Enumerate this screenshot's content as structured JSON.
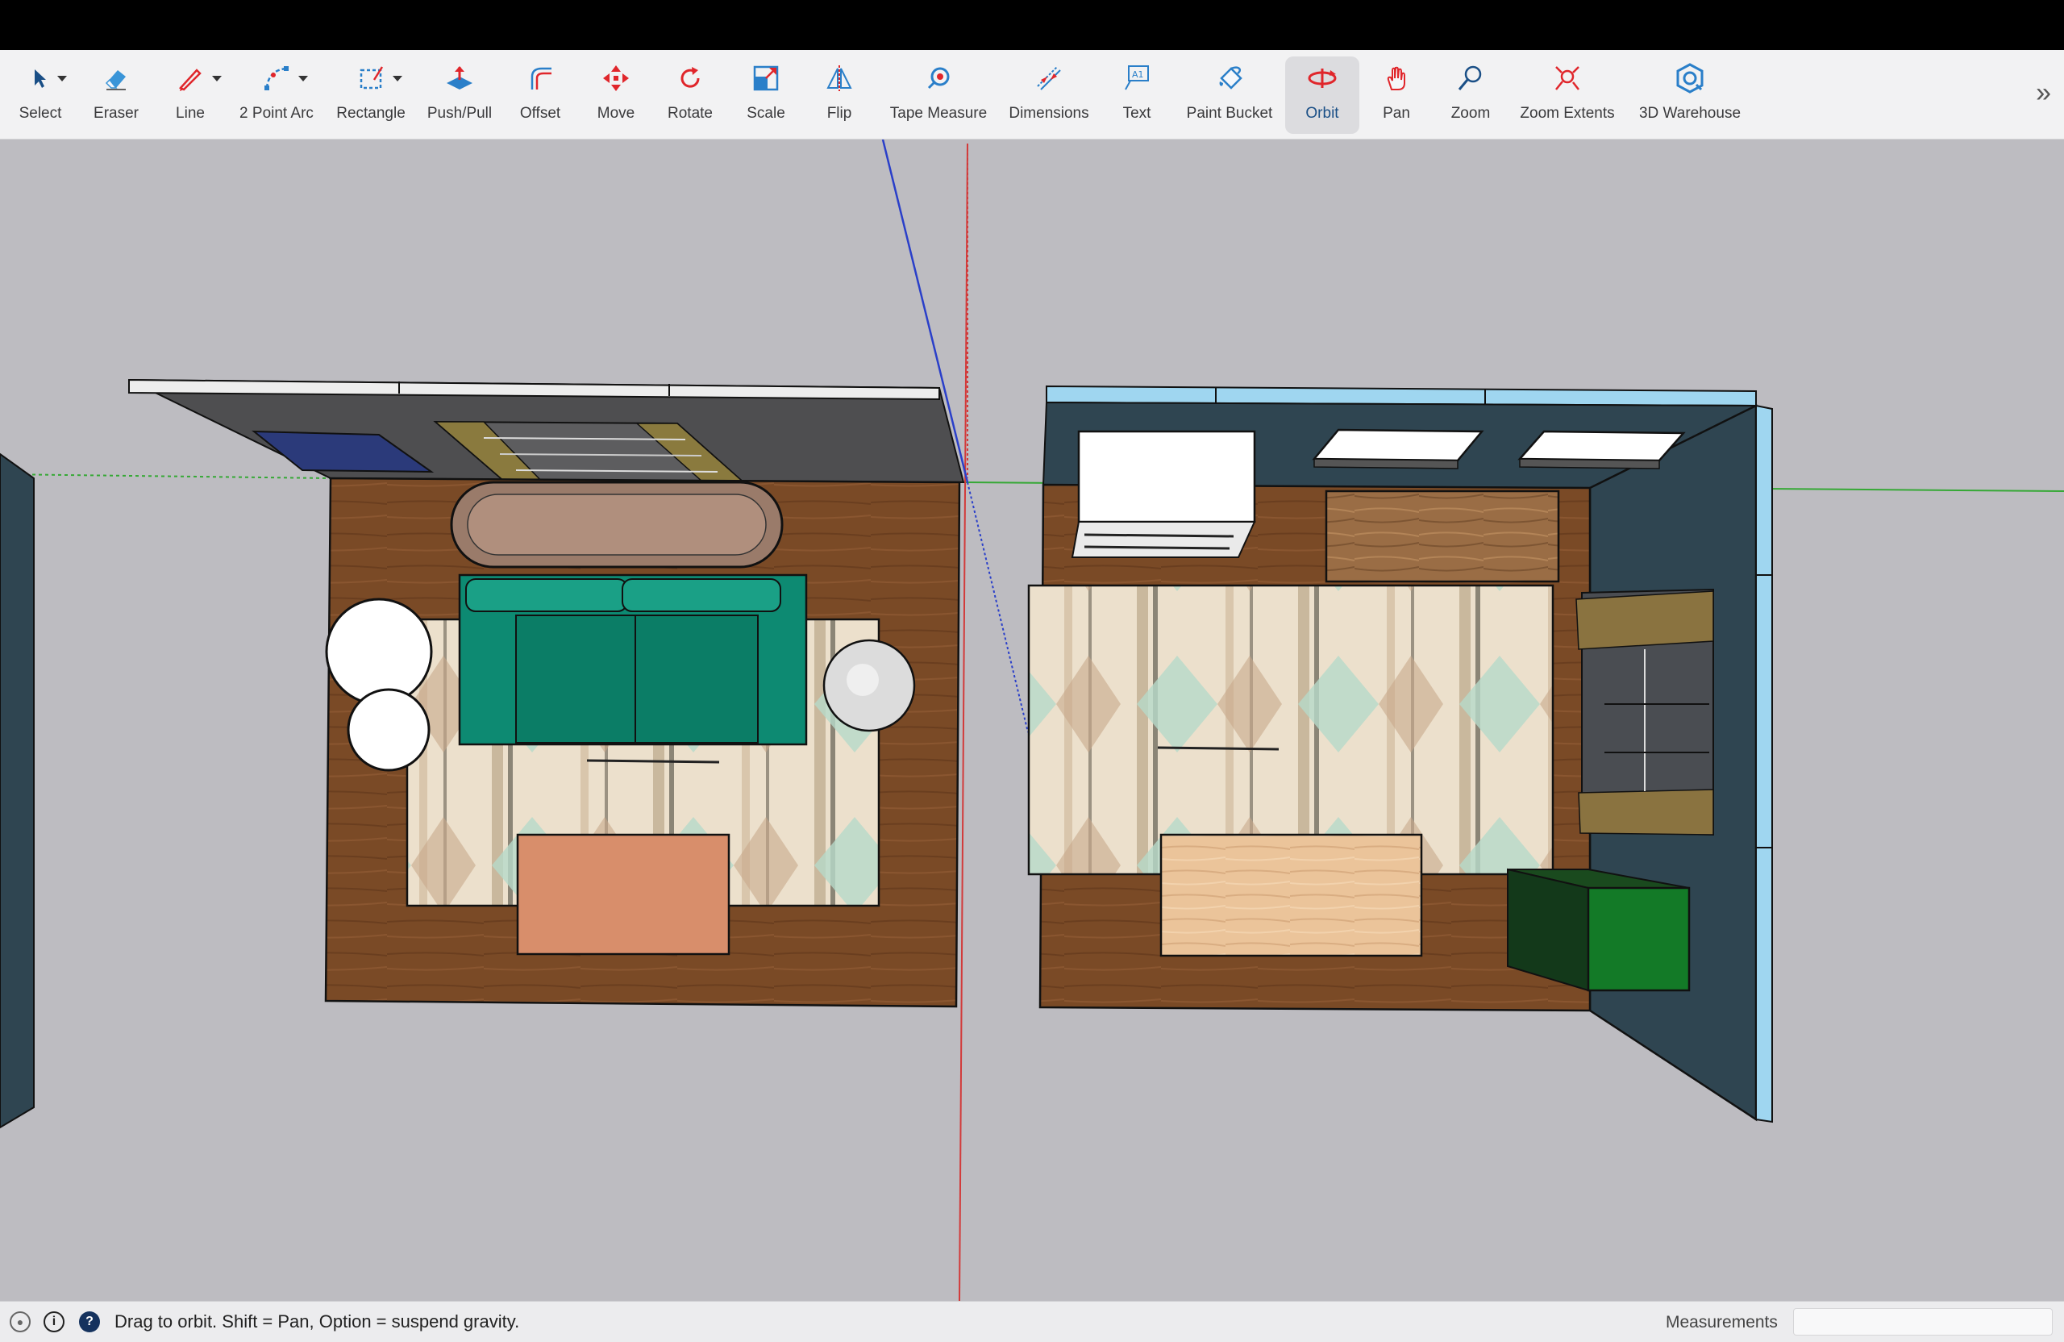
{
  "toolbar": {
    "tools": [
      {
        "label": "Select",
        "icon": "select-arrow-icon"
      },
      {
        "label": "Eraser",
        "icon": "eraser-icon"
      },
      {
        "label": "Line",
        "icon": "pencil-line-icon"
      },
      {
        "label": "2 Point Arc",
        "icon": "two-point-arc-icon"
      },
      {
        "label": "Rectangle",
        "icon": "rectangle-icon"
      },
      {
        "label": "Push/Pull",
        "icon": "push-pull-icon"
      },
      {
        "label": "Offset",
        "icon": "offset-icon"
      },
      {
        "label": "Move",
        "icon": "move-icon"
      },
      {
        "label": "Rotate",
        "icon": "rotate-icon"
      },
      {
        "label": "Scale",
        "icon": "scale-icon"
      },
      {
        "label": "Flip",
        "icon": "flip-icon"
      },
      {
        "label": "Tape Measure",
        "icon": "tape-measure-icon"
      },
      {
        "label": "Dimensions",
        "icon": "dimensions-icon"
      },
      {
        "label": "Text",
        "icon": "text-icon"
      },
      {
        "label": "Paint Bucket",
        "icon": "paint-bucket-icon"
      },
      {
        "label": "Orbit",
        "icon": "orbit-icon"
      },
      {
        "label": "Pan",
        "icon": "pan-hand-icon"
      },
      {
        "label": "Zoom",
        "icon": "zoom-icon"
      },
      {
        "label": "Zoom Extents",
        "icon": "zoom-extents-icon"
      },
      {
        "label": "3D Warehouse",
        "icon": "warehouse-icon"
      }
    ],
    "active_tool": "Orbit",
    "overflow_glyph": "»"
  },
  "status": {
    "hint": "Drag to orbit. Shift = Pan, Option = suspend gravity.",
    "measurements_label": "Measurements",
    "measurements_value": ""
  },
  "colors": {
    "accent": "#e0262b",
    "tool_blue": "#2a7fc9",
    "floor": "#7a4a26",
    "wall_dark": "#2f4551",
    "wall_top": "#9fd6f0",
    "sofa": "#0d8a72",
    "rug_light": "#eee2cf",
    "axis_red": "#d23a3a",
    "axis_green": "#35a835",
    "axis_blue": "#2a3fc9"
  }
}
